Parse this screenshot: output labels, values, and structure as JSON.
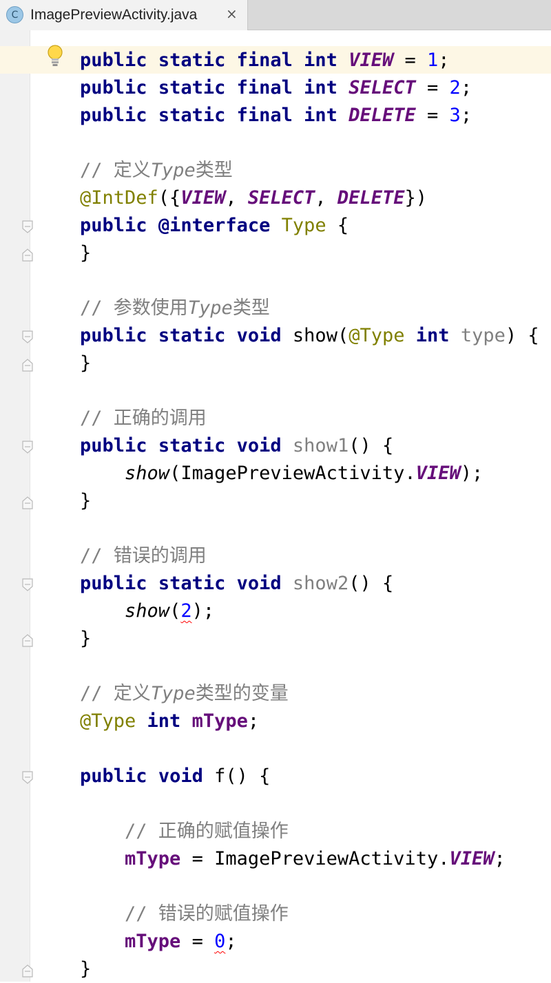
{
  "tab": {
    "icon_letter": "C",
    "title": "ImagePreviewActivity.java",
    "close": "×"
  },
  "code": {
    "kw_public": "public",
    "kw_static": "static",
    "kw_final": "final",
    "kw_int": "int",
    "kw_void": "void",
    "kw_interface": "@interface",
    "c_view": "VIEW",
    "c_select": "SELECT",
    "c_delete": "DELETE",
    "n1": "1",
    "n2": "2",
    "n3": "3",
    "n0": "0",
    "eq": " = ",
    "semi": ";",
    "cmt_def_a": "// 定义",
    "cmt_def_b": "Type",
    "cmt_def_c": "类型",
    "ann_intdef": "@IntDef",
    "intdef_open": "({",
    "intdef_sep": ", ",
    "intdef_close": "})",
    "type_name": "Type",
    "brace_open": " {",
    "brace_close": "}",
    "cmt_param_a": "// 参数使用",
    "cmt_param_b": "Type",
    "cmt_param_c": "类型",
    "m_show": "show",
    "paren_open": "(",
    "ann_type": "@Type",
    "param_type": "type",
    "paren_close_brace": ") {",
    "cmt_correct_call": "// 正确的调用",
    "m_show1": "show1",
    "m_show2": "show2",
    "empty_parens_brace": "() {",
    "cls_ref": "ImagePreviewActivity.",
    "call_end": ");",
    "cmt_wrong_call": "// 错误的调用",
    "cmt_var_a": "// 定义",
    "cmt_var_b": "Type",
    "cmt_var_c": "类型的变量",
    "f_mtype": "mType",
    "m_f": "f",
    "cmt_correct_assign": "// 正确的赋值操作",
    "cmt_wrong_assign": "// 错误的赋值操作"
  },
  "colors": {
    "keyword": "#000080",
    "constant": "#660e7a",
    "number": "#0000ff",
    "comment": "#808080",
    "annotation": "#808000",
    "caret_line": "#fdf7e5",
    "gutter": "#f1f1f1"
  },
  "icons": [
    "class-file-icon",
    "close-icon",
    "intention-bulb-icon",
    "fold-open-icon",
    "fold-close-icon"
  ]
}
